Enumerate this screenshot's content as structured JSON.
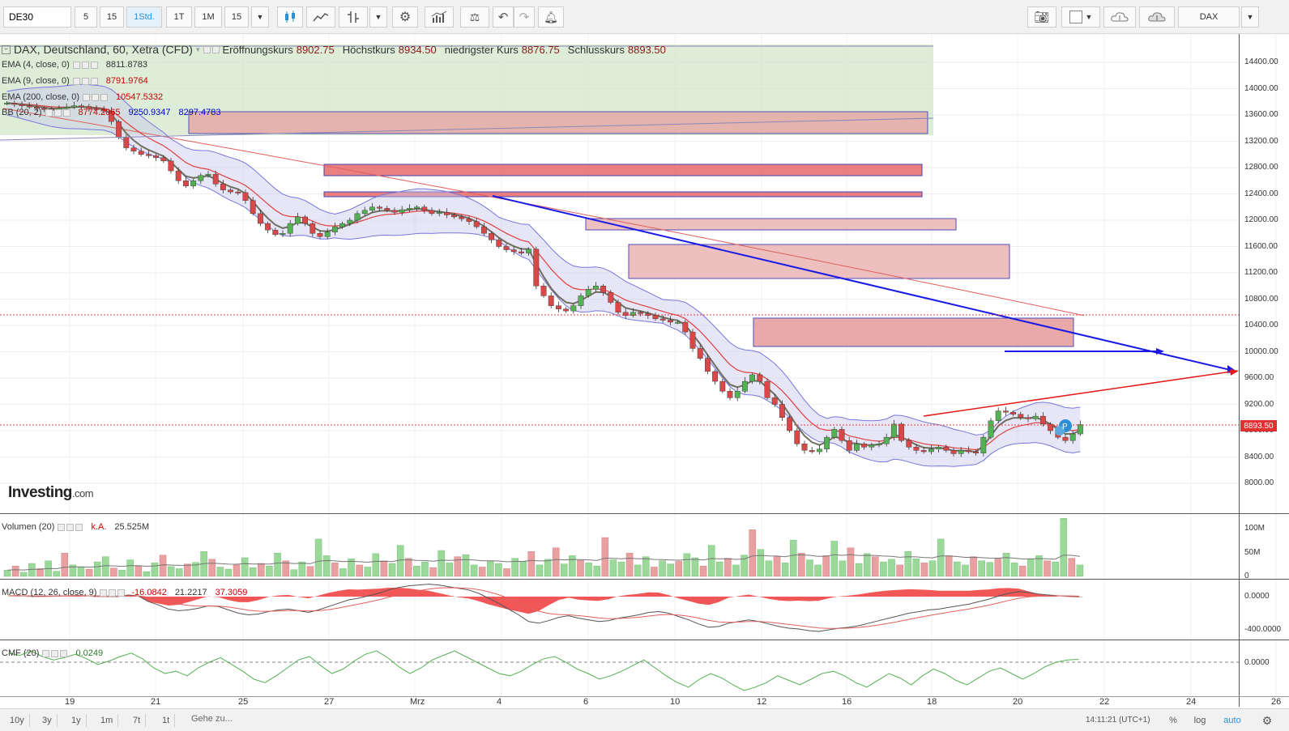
{
  "toolbar": {
    "symbol": "DE30",
    "intervals": [
      "5",
      "15",
      "1Std.",
      "1T",
      "1M",
      "15"
    ],
    "active_interval": "1Std.",
    "icons": [
      "candlestick-icon",
      "line-chart-icon",
      "bar-tool-icon",
      "settings-icon",
      "indicators-icon",
      "compare-icon",
      "undo-icon",
      "redo-icon",
      "alert-icon"
    ],
    "right_icons": [
      "camera-icon",
      "color-box-icon",
      "cloud-download-icon",
      "cloud-upload-icon"
    ],
    "dax_label": "DAX"
  },
  "main_legend": {
    "title": "DAX, Deutschland, 60, Xetra (CFD)",
    "open_label": "Eröffnungskurs",
    "open_value": "8902.75",
    "high_label": "Höchstkurs",
    "high_value": "8934.50",
    "low_label": "niedrigster Kurs",
    "low_value": "8876.75",
    "close_label": "Schlusskurs",
    "close_value": "8893.50"
  },
  "indicators": [
    {
      "label": "EMA (4, close, 0)",
      "values": [
        "8811.8783"
      ],
      "colors": [
        "#333333"
      ]
    },
    {
      "label": "EMA (9, close, 0)",
      "values": [
        "8791.9764"
      ],
      "colors": [
        "#cc0000"
      ]
    },
    {
      "label": "EMA (200, close, 0)",
      "values": [
        "10547.5332"
      ],
      "colors": [
        "#cc0000"
      ]
    },
    {
      "label": "BB (20, 2)",
      "values": [
        "8774.2065",
        "9250.9347",
        "8297.4783"
      ],
      "colors": [
        "#cc0000",
        "#0000cc",
        "#0000cc"
      ]
    }
  ],
  "price_axis": [
    "14400.00",
    "14000.00",
    "13600.00",
    "13200.00",
    "12800.00",
    "12400.00",
    "12000.00",
    "11600.00",
    "11200.00",
    "10800.00",
    "10400.00",
    "10000.00",
    "9600.00",
    "9200.00",
    "8800.00",
    "8400.00",
    "8000.00"
  ],
  "last_price": "8893.50",
  "volume": {
    "label": "Volumen (20)",
    "na": "k.A.",
    "value": "25.525M",
    "axis": [
      "100M",
      "50M",
      "0"
    ]
  },
  "macd": {
    "label": "MACD (12, 26, close, 9)",
    "values": [
      "-16.0842",
      "21.2217",
      "37.3059"
    ],
    "axis": [
      "0.0000",
      "-400.0000"
    ]
  },
  "cmf": {
    "label": "CMF (20)",
    "value": "0.0249",
    "axis": [
      "0.0000"
    ]
  },
  "x_axis": [
    "19",
    "21",
    "25",
    "27",
    "Mrz",
    "4",
    "6",
    "10",
    "12",
    "16",
    "18",
    "20",
    "22",
    "24",
    "26"
  ],
  "logo": {
    "main": "Investing",
    "suffix": ".com"
  },
  "bottom": {
    "ranges": [
      "10y",
      "3y",
      "1y",
      "1m",
      "7t",
      "1t"
    ],
    "goto": "Gehe zu...",
    "clock": "14:11:21 (UTC+1)",
    "percent": "%",
    "log": "log",
    "auto": "auto"
  },
  "colors": {
    "bull": "#52b152",
    "bear": "#d84848",
    "trend_blue": "#1a1ae6",
    "trend_red": "#e61a1a"
  },
  "chart_data": {
    "type": "candlestick",
    "title": "DAX, Deutschland, 60, Xetra (CFD)",
    "y_range": [
      7800,
      14600
    ],
    "x_labels": [
      "19",
      "21",
      "25",
      "27",
      "Mrz",
      "4",
      "6",
      "10",
      "12",
      "16",
      "18",
      "20",
      "22",
      "24",
      "26"
    ],
    "close_path": [
      13780,
      13760,
      13740,
      13720,
      13700,
      13690,
      13680,
      13700,
      13720,
      13740,
      13730,
      13700,
      13680,
      13660,
      13500,
      13260,
      13100,
      13050,
      13000,
      12980,
      12950,
      12900,
      12750,
      12600,
      12520,
      12600,
      12680,
      12700,
      12550,
      12460,
      12430,
      12420,
      12300,
      12100,
      11950,
      11850,
      11780,
      11800,
      11950,
      12050,
      11950,
      11800,
      11750,
      11820,
      11900,
      11950,
      12000,
      12100,
      12150,
      12200,
      12180,
      12150,
      12120,
      12160,
      12180,
      12200,
      12150,
      12100,
      12120,
      12080,
      12050,
      12020,
      11980,
      11900,
      11800,
      11700,
      11600,
      11550,
      11520,
      11500,
      11560,
      11000,
      10850,
      10700,
      10650,
      10620,
      10700,
      10850,
      10950,
      11000,
      10900,
      10750,
      10600,
      10550,
      10600,
      10580,
      10550,
      10500,
      10480,
      10450,
      10450,
      10300,
      10050,
      9900,
      9700,
      9550,
      9400,
      9300,
      9400,
      9550,
      9650,
      9550,
      9300,
      9200,
      9000,
      8800,
      8600,
      8500,
      8480,
      8520,
      8700,
      8820,
      8650,
      8500,
      8600,
      8550,
      8580,
      8600,
      8700,
      8900,
      8650,
      8550,
      8500,
      8480,
      8520,
      8550,
      8500,
      8450,
      8500,
      8480,
      8460,
      8700,
      8950,
      9100,
      9080,
      9050,
      9000,
      8980,
      9020,
      8900,
      8800,
      8700,
      8650,
      8750,
      8893
    ],
    "ema200_start_end": [
      13700,
      10550
    ],
    "volume_bars": [
      12,
      20,
      8,
      25,
      15,
      30,
      10,
      45,
      22,
      18,
      14,
      28,
      38,
      16,
      12,
      32,
      20,
      9,
      26,
      41,
      19,
      15,
      24,
      27,
      48,
      33,
      18,
      14,
      22,
      36,
      17,
      25,
      20,
      45,
      30,
      13,
      28,
      19,
      72,
      40,
      26,
      15,
      34,
      22,
      18,
      44,
      30,
      25,
      60,
      35,
      20,
      28,
      17,
      50,
      26,
      38,
      42,
      22,
      18,
      30,
      25,
      15,
      35,
      29,
      48,
      22,
      33,
      55,
      24,
      40,
      31,
      26,
      20,
      75,
      32,
      28,
      45,
      22,
      38,
      18,
      30,
      24,
      29,
      44,
      36,
      20,
      60,
      28,
      35,
      22,
      41,
      90,
      52,
      30,
      38,
      26,
      70,
      45,
      32,
      22,
      40,
      68,
      30,
      55,
      25,
      44,
      38,
      28,
      33,
      22,
      48,
      34,
      26,
      30,
      72,
      40,
      28,
      22,
      38,
      30,
      27,
      35,
      45,
      26,
      20,
      34,
      40,
      30,
      28,
      112,
      35,
      22
    ],
    "macd_values": [
      10,
      12,
      8,
      5,
      6,
      9,
      11,
      14,
      10,
      6,
      4,
      3,
      20,
      10,
      -60,
      -100,
      -150,
      -170,
      -160,
      -140,
      -110,
      -120,
      -160,
      -200,
      -220,
      -210,
      -180,
      -160,
      -150,
      -170,
      -190,
      -160,
      -120,
      -80,
      -40,
      -20,
      10,
      40,
      80,
      110,
      130,
      140,
      150,
      140,
      120,
      100,
      80,
      40,
      -20,
      -80,
      -150,
      -220,
      -300,
      -320,
      -290,
      -250,
      -230,
      -260,
      -280,
      -300,
      -290,
      -260,
      -240,
      -220,
      -190,
      -180,
      -200,
      -240,
      -280,
      -330,
      -370,
      -360,
      -320,
      -300,
      -280,
      -300,
      -330,
      -360,
      -380,
      -390,
      -410,
      -420,
      -400,
      -380,
      -370,
      -350,
      -320,
      -290,
      -260,
      -230,
      -200,
      -180,
      -160,
      -150,
      -130,
      -110,
      -90,
      -60,
      -30,
      10,
      40,
      60,
      50,
      30,
      20,
      10,
      5,
      0
    ],
    "cmf_values": [
      0.08,
      0.06,
      0.1,
      0.05,
      0.02,
      0.04,
      0.07,
      0.03,
      -0.02,
      0.01,
      0.05,
      0.08,
      0.03,
      -0.05,
      -0.1,
      -0.08,
      -0.12,
      -0.05,
      0.0,
      0.04,
      -0.02,
      -0.08,
      -0.15,
      -0.18,
      -0.12,
      -0.05,
      0.02,
      0.05,
      -0.03,
      -0.1,
      -0.06,
      0.01,
      0.07,
      0.1,
      0.04,
      -0.04,
      -0.1,
      -0.05,
      0.02,
      0.06,
      0.1,
      0.05,
      0.0,
      -0.05,
      -0.1,
      -0.12,
      -0.08,
      -0.02,
      0.03,
      0.05,
      0.0,
      -0.06,
      -0.1,
      -0.15,
      -0.12,
      -0.08,
      -0.03,
      0.02,
      -0.05,
      -0.12,
      -0.18,
      -0.22,
      -0.15,
      -0.1,
      -0.14,
      -0.2,
      -0.25,
      -0.22,
      -0.18,
      -0.12,
      -0.16,
      -0.2,
      -0.15,
      -0.1,
      -0.08,
      -0.12,
      -0.18,
      -0.22,
      -0.16,
      -0.1,
      -0.14,
      -0.2,
      -0.12,
      -0.06,
      -0.1,
      -0.16,
      -0.2,
      -0.14,
      -0.08,
      -0.05,
      -0.1,
      -0.15,
      -0.1,
      -0.04,
      0.0,
      0.02,
      0.0249
    ]
  }
}
